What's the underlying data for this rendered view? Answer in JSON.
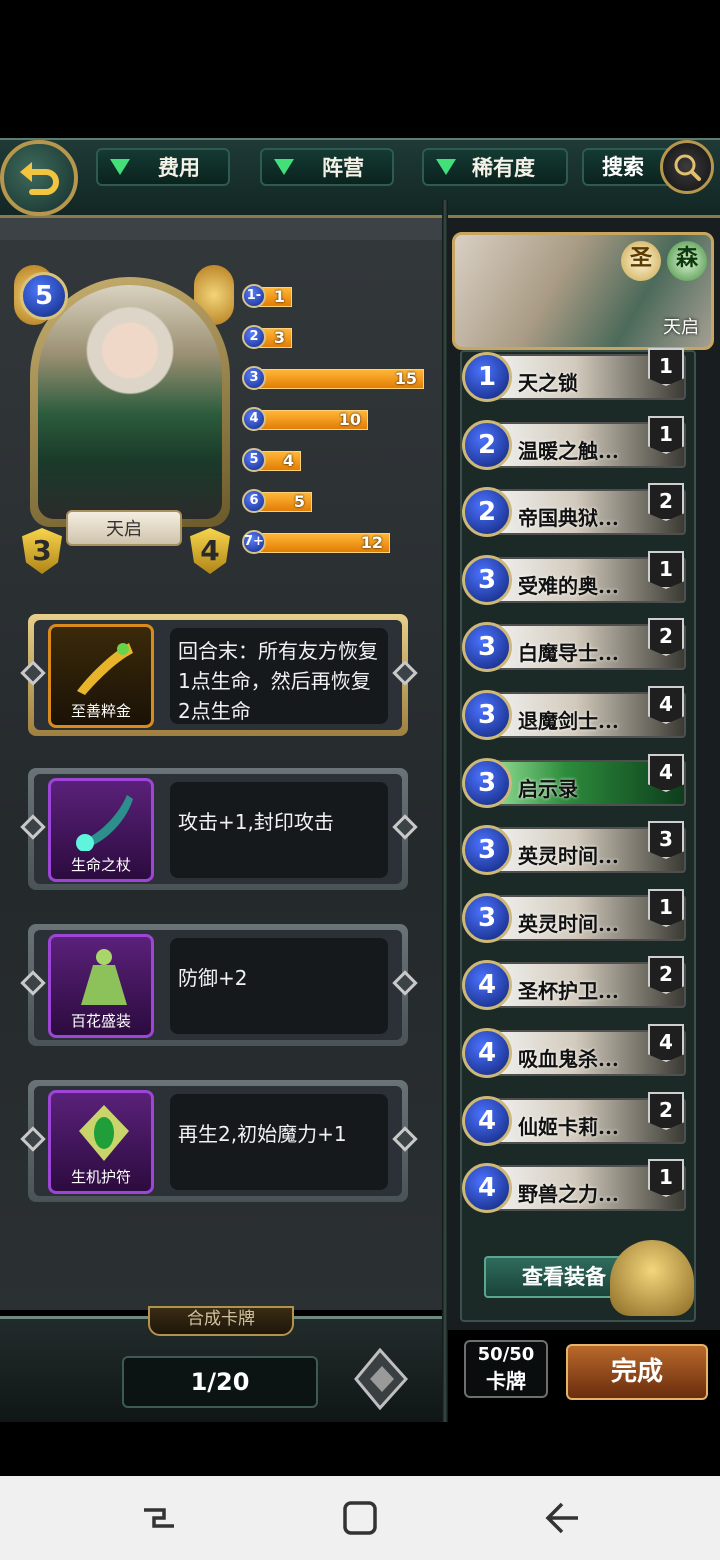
{
  "filters": {
    "cost": "费用",
    "faction": "阵营",
    "rarity": "稀有度",
    "search": "搜索"
  },
  "hero": {
    "name": "天启",
    "cost": "5",
    "attack": "3",
    "health": "4",
    "factions": [
      "圣",
      "森"
    ]
  },
  "curve": [
    {
      "label": "1-",
      "value": "1",
      "count": 1
    },
    {
      "label": "2",
      "value": "3",
      "count": 3
    },
    {
      "label": "3",
      "value": "15",
      "count": 15
    },
    {
      "label": "4",
      "value": "10",
      "count": 10
    },
    {
      "label": "5",
      "value": "4",
      "count": 4
    },
    {
      "label": "6",
      "value": "5",
      "count": 5
    },
    {
      "label": "7+",
      "value": "12",
      "count": 12
    }
  ],
  "equipment": [
    {
      "name": "至善粹金",
      "desc": "回合末：所有友方恢复1点生命，然后再恢复2点生命"
    },
    {
      "name": "生命之杖",
      "desc": "攻击+1,封印攻击"
    },
    {
      "name": "百花盛装",
      "desc": "防御+2"
    },
    {
      "name": "生机护符",
      "desc": "再生2,初始魔力+1"
    }
  ],
  "combine_tab": "合成卡牌",
  "page": "1/20",
  "deck": [
    {
      "cost": "1",
      "name": "天之锁",
      "count": "1"
    },
    {
      "cost": "2",
      "name": "温暖之触...",
      "count": "1"
    },
    {
      "cost": "2",
      "name": "帝国典狱...",
      "count": "2"
    },
    {
      "cost": "3",
      "name": "受难的奥...",
      "count": "1"
    },
    {
      "cost": "3",
      "name": "白魔导士...",
      "count": "2"
    },
    {
      "cost": "3",
      "name": "退魔剑士...",
      "count": "4"
    },
    {
      "cost": "3",
      "name": "启示录",
      "count": "4"
    },
    {
      "cost": "3",
      "name": "英灵时间...",
      "count": "3"
    },
    {
      "cost": "3",
      "name": "英灵时间...",
      "count": "1"
    },
    {
      "cost": "4",
      "name": "圣杯护卫...",
      "count": "2"
    },
    {
      "cost": "4",
      "name": "吸血鬼杀...",
      "count": "4"
    },
    {
      "cost": "4",
      "name": "仙姬卡莉...",
      "count": "2"
    },
    {
      "cost": "4",
      "name": "野兽之力...",
      "count": "1"
    }
  ],
  "view_equipment": "查看装备",
  "card_count": {
    "value": "50/50",
    "label": "卡牌"
  },
  "done": "完成",
  "colors": {
    "accent_gold": "#b6974d",
    "bar_orange": "#f29b1c",
    "cost_blue": "#2447c9"
  }
}
